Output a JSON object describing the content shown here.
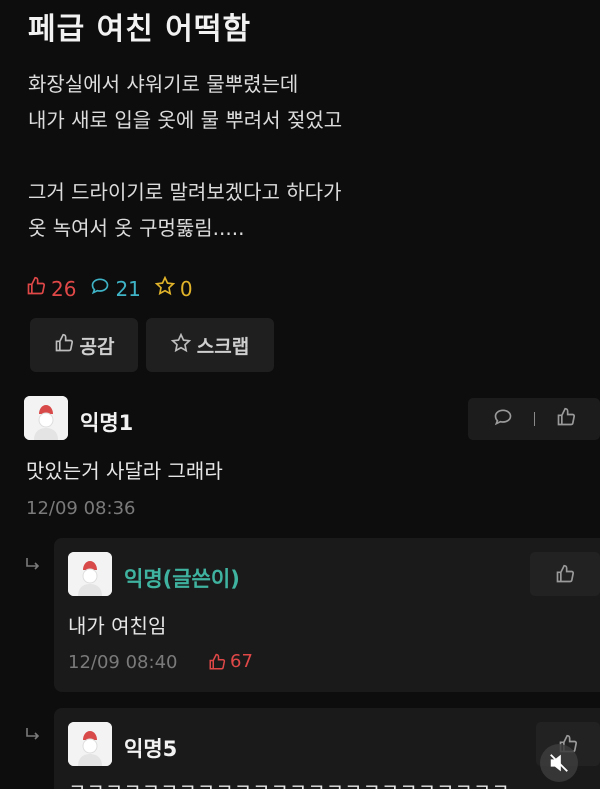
{
  "post": {
    "title": "페급 여친 어떡함",
    "body_lines": [
      "화장실에서 샤워기로 물뿌렸는데",
      "내가 새로 입을 옷에 물 뿌려서 젖었고",
      "",
      "그거 드라이기로 말려보겠다고 하다가",
      "옷 녹여서 옷 구멍뚫림....."
    ],
    "likes": "26",
    "comments": "21",
    "scraps": "0",
    "like_button": "공감",
    "scrap_button": "스크랩"
  },
  "comments": [
    {
      "author": "익명1",
      "text": "맛있는거 사달라 그래라",
      "time": "12/09 08:36"
    }
  ],
  "replies": [
    {
      "author": "익명(글쓴이)",
      "text": "내가 여친임",
      "time": "12/09 08:40",
      "likes": "67"
    },
    {
      "author": "익명5",
      "text": "ㅋㅋㅋㅋㅋㅋㅋㅋㅋㅋㅋㅋㅋㅋㅋㅋㅋㅋㅋㅋㅋㅋㅋㅋ"
    }
  ],
  "colors": {
    "background": "#0d0d0d",
    "like": "#e04848",
    "comment": "#3fb3c6",
    "scrap": "#e0b32a",
    "op_name": "#3fb3a0"
  },
  "icons": [
    "thumbs-up-icon",
    "speech-bubble-icon",
    "star-icon",
    "reply-arrow-icon",
    "default-avatar-icon",
    "mute-icon"
  ]
}
